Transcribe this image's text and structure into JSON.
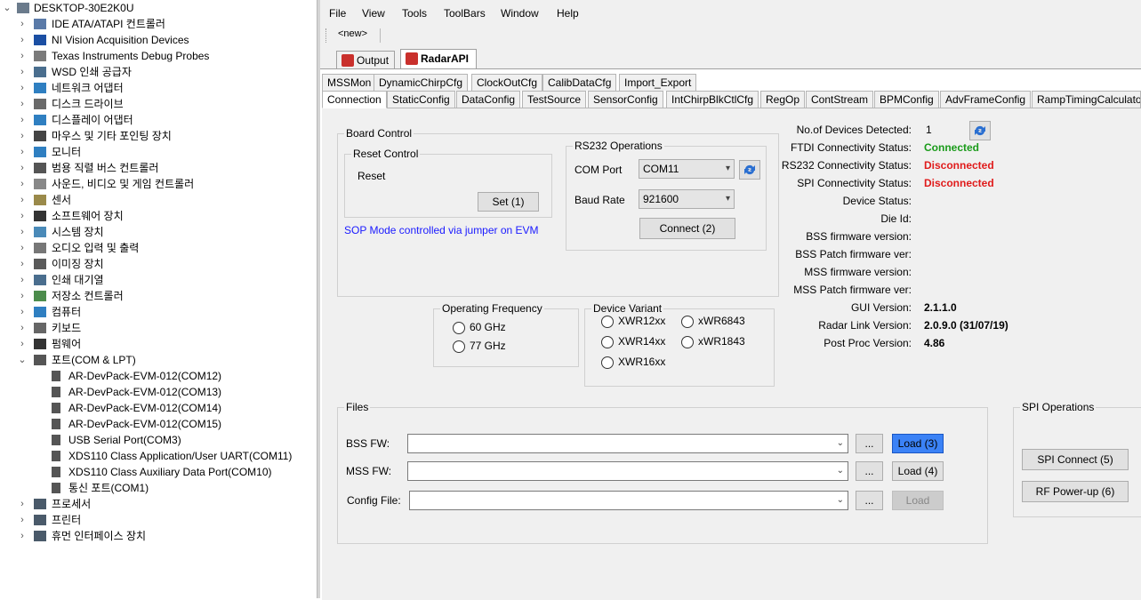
{
  "device_manager": {
    "root": "DESKTOP-30E2K0U",
    "categories": [
      {
        "label": "IDE ATA/ATAPI 컨트롤러",
        "icon": "ide-controller-icon"
      },
      {
        "label": "NI Vision Acquisition Devices",
        "icon": "ni-vision-icon"
      },
      {
        "label": "Texas Instruments Debug Probes",
        "icon": "debug-probe-icon"
      },
      {
        "label": "WSD 인쇄 공급자",
        "icon": "printer-icon"
      },
      {
        "label": "네트워크 어댑터",
        "icon": "network-adapter-icon"
      },
      {
        "label": "디스크 드라이브",
        "icon": "disk-drive-icon"
      },
      {
        "label": "디스플레이 어댑터",
        "icon": "display-adapter-icon"
      },
      {
        "label": "마우스 및 기타 포인팅 장치",
        "icon": "mouse-icon"
      },
      {
        "label": "모니터",
        "icon": "monitor-icon"
      },
      {
        "label": "범용 직렬 버스 컨트롤러",
        "icon": "usb-icon"
      },
      {
        "label": "사운드, 비디오 및 게임 컨트롤러",
        "icon": "speaker-icon"
      },
      {
        "label": "센서",
        "icon": "sensor-icon"
      },
      {
        "label": "소프트웨어 장치",
        "icon": "software-device-icon"
      },
      {
        "label": "시스템 장치",
        "icon": "system-device-icon"
      },
      {
        "label": "오디오 입력 및 출력",
        "icon": "audio-icon"
      },
      {
        "label": "이미징 장치",
        "icon": "camera-icon"
      },
      {
        "label": "인쇄 대기열",
        "icon": "print-queue-icon"
      },
      {
        "label": "저장소 컨트롤러",
        "icon": "storage-controller-icon"
      },
      {
        "label": "컴퓨터",
        "icon": "computer-icon"
      },
      {
        "label": "키보드",
        "icon": "keyboard-icon"
      },
      {
        "label": "펌웨어",
        "icon": "firmware-icon"
      },
      {
        "label": "포트(COM & LPT)",
        "icon": "port-icon",
        "expanded": true
      }
    ],
    "ports": [
      "AR-DevPack-EVM-012(COM12)",
      "AR-DevPack-EVM-012(COM13)",
      "AR-DevPack-EVM-012(COM14)",
      "AR-DevPack-EVM-012(COM15)",
      "USB Serial Port(COM3)",
      "XDS110 Class Application/User UART(COM11)",
      "XDS110 Class Auxiliary Data Port(COM10)",
      "통신 포트(COM1)"
    ],
    "after": [
      {
        "label": "프로세서",
        "icon": "processor-icon"
      },
      {
        "label": "프린터",
        "icon": "printer-icon"
      },
      {
        "label": "휴먼 인터페이스 장치",
        "icon": "hid-icon"
      }
    ]
  },
  "app": {
    "menu": [
      "File",
      "View",
      "Tools",
      "ToolBars",
      "Window",
      "Help"
    ],
    "toolbar_new": "<new>",
    "doc_tabs": [
      "Output",
      "RadarAPI"
    ],
    "tabs_row1": [
      "MSSMon",
      "DynamicChirpCfg",
      "ClockOutCfg",
      "CalibDataCfg",
      "Import_Export"
    ],
    "tabs_row2": [
      "Connection",
      "StaticConfig",
      "DataConfig",
      "TestSource",
      "SensorConfig",
      "IntChirpBlkCtlCfg",
      "RegOp",
      "ContStream",
      "BPMConfig",
      "AdvFrameConfig",
      "RampTimingCalculato"
    ],
    "board_control": {
      "title": "Board Control",
      "reset_control_title": "Reset Control",
      "reset_label": "Reset",
      "set_button": "Set (1)",
      "sop_note": "SOP Mode controlled via jumper on EVM"
    },
    "rs232": {
      "title": "RS232 Operations",
      "com_port_label": "COM Port",
      "com_port_value": "COM11",
      "baud_label": "Baud Rate",
      "baud_value": "921600",
      "connect_button": "Connect (2)"
    },
    "operating_frequency": {
      "title": "Operating Frequency",
      "options": [
        "60 GHz",
        "77 GHz"
      ]
    },
    "device_variant": {
      "title": "Device Variant",
      "options": [
        "XWR12xx",
        "XWR14xx",
        "XWR16xx",
        "xWR6843",
        "xWR1843"
      ]
    },
    "status": {
      "devices_detected_label": "No.of Devices Detected:",
      "devices_detected_value": "1",
      "rows": [
        {
          "label": "FTDI Connectivity Status:",
          "value": "Connected",
          "color": "#1a9b1a"
        },
        {
          "label": "RS232 Connectivity Status:",
          "value": "Disconnected",
          "color": "#e01b1b"
        },
        {
          "label": "SPI Connectivity Status:",
          "value": "Disconnected",
          "color": "#e01b1b"
        },
        {
          "label": "Device Status:",
          "value": ""
        },
        {
          "label": "Die Id:",
          "value": ""
        },
        {
          "label": "BSS firmware version:",
          "value": ""
        },
        {
          "label": "BSS Patch firmware ver:",
          "value": ""
        },
        {
          "label": "MSS firmware version:",
          "value": ""
        },
        {
          "label": "MSS Patch firmware ver:",
          "value": ""
        },
        {
          "label": "GUI Version:",
          "value": "2.1.1.0"
        },
        {
          "label": "Radar Link Version:",
          "value": "2.0.9.0 (31/07/19)"
        },
        {
          "label": "Post Proc Version:",
          "value": "4.86"
        }
      ]
    },
    "files": {
      "title": "Files",
      "rows": [
        {
          "label": "BSS FW:",
          "browse": "...",
          "load": "Load (3)"
        },
        {
          "label": "MSS FW:",
          "browse": "...",
          "load": "Load (4)"
        },
        {
          "label": "Config File:",
          "browse": "...",
          "load": "Load"
        }
      ]
    },
    "spi": {
      "title": "SPI Operations",
      "connect": "SPI Connect (5)",
      "rf_power": "RF Power-up (6)"
    }
  }
}
